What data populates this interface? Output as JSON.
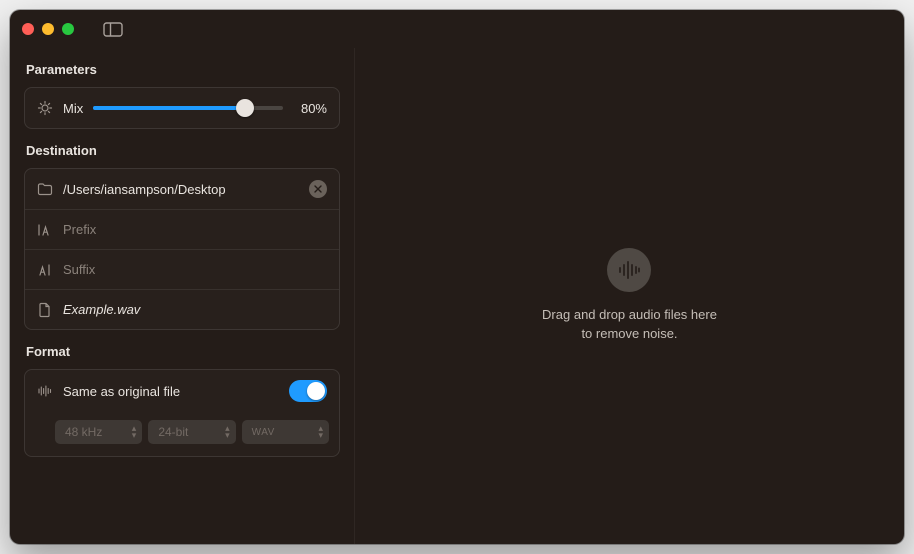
{
  "parameters": {
    "title": "Parameters",
    "mix_label": "Mix",
    "mix_value": 80,
    "mix_display": "80%"
  },
  "destination": {
    "title": "Destination",
    "path": "/Users/iansampson/Desktop",
    "prefix_placeholder": "Prefix",
    "prefix_value": "",
    "suffix_placeholder": "Suffix",
    "suffix_value": "",
    "example_label": "Example.wav"
  },
  "format": {
    "title": "Format",
    "same_as_original_label": "Same as original file",
    "same_as_original_on": true,
    "sample_rate": "48 kHz",
    "bit_depth": "24-bit",
    "container": "WAV"
  },
  "drop": {
    "line1": "Drag and drop audio files here",
    "line2": "to remove noise."
  }
}
